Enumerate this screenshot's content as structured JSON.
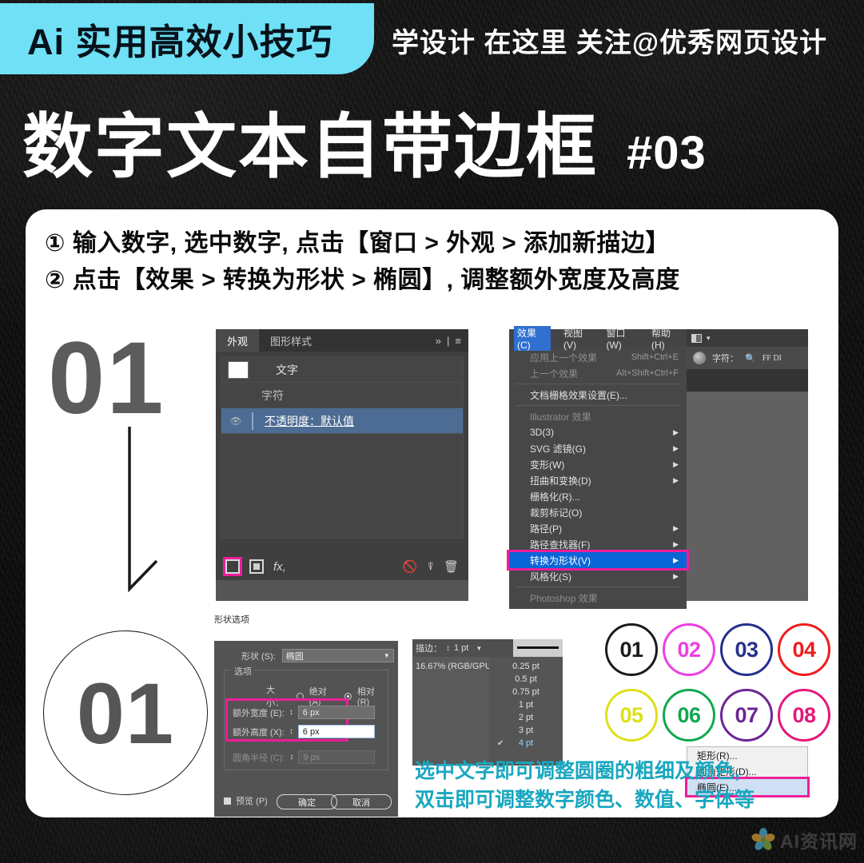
{
  "header": {
    "brand_tag": "Ai 实用高效小技巧",
    "slogan": "学设计 在这里  关注@优秀网页设计",
    "title": "数字文本自带边框",
    "issue": "#03",
    "cyan": "#6FE0F5"
  },
  "steps": [
    "① 输入数字, 选中数字, 点击【窗口 > 外观 > 添加新描边】",
    "② 点击【效果 > 转换为形状 > 椭圆】, 调整额外宽度及高度"
  ],
  "left_demo": {
    "plain_number": "01",
    "circled_number": "01"
  },
  "appearance_panel": {
    "tabs": [
      {
        "label": "外观",
        "active": true
      },
      {
        "label": "图形样式",
        "active": false
      }
    ],
    "tab_controls": {
      "expand": "»",
      "divider": "|",
      "menu": "≡"
    },
    "rows": [
      {
        "label": "文字",
        "type": "swatch",
        "selected": false
      },
      {
        "label": "字符",
        "type": "indent",
        "selected": false
      },
      {
        "label": "不透明度：默认值",
        "type": "eye",
        "selected": true
      }
    ],
    "footer_icons": [
      "add-new-stroke",
      "add-new-fill",
      "fx",
      "clear",
      "duplicate",
      "delete"
    ],
    "fx_label": "fx,",
    "tooltip": "添加新描边"
  },
  "effects_menu": {
    "menubar": [
      {
        "label": "效果(C)",
        "active": true
      },
      {
        "label": "视图(V)",
        "active": false
      },
      {
        "label": "窗口(W)",
        "active": false
      },
      {
        "label": "帮助(H)",
        "active": false
      }
    ],
    "items": [
      {
        "label": "应用上一个效果",
        "shortcut": "Shift+Ctrl+E",
        "dim": true,
        "arrow": false
      },
      {
        "label": "上一个效果",
        "shortcut": "Alt+Shift+Ctrl+F",
        "dim": true,
        "arrow": false
      },
      {
        "divider": true
      },
      {
        "label": "文档栅格效果设置(E)...",
        "shortcut": "",
        "dim": false,
        "arrow": false
      },
      {
        "divider": true
      },
      {
        "label": "Illustrator 效果",
        "shortcut": "",
        "dim": true,
        "arrow": false
      },
      {
        "label": "3D(3)",
        "shortcut": "",
        "dim": false,
        "arrow": true
      },
      {
        "label": "SVG 滤镜(G)",
        "shortcut": "",
        "dim": false,
        "arrow": true
      },
      {
        "label": "变形(W)",
        "shortcut": "",
        "dim": false,
        "arrow": true
      },
      {
        "label": "扭曲和变换(D)",
        "shortcut": "",
        "dim": false,
        "arrow": true
      },
      {
        "label": "栅格化(R)...",
        "shortcut": "",
        "dim": false,
        "arrow": false
      },
      {
        "label": "裁剪标记(O)",
        "shortcut": "",
        "dim": false,
        "arrow": false
      },
      {
        "label": "路径(P)",
        "shortcut": "",
        "dim": false,
        "arrow": true
      },
      {
        "label": "路径查找器(F)",
        "shortcut": "",
        "dim": false,
        "arrow": true
      },
      {
        "label": "转换为形状(V)",
        "shortcut": "",
        "dim": false,
        "arrow": true,
        "highlight": true
      },
      {
        "label": "风格化(S)",
        "shortcut": "",
        "dim": false,
        "arrow": true
      },
      {
        "divider": true
      },
      {
        "label": "Photoshop 效果",
        "shortcut": "",
        "dim": true,
        "arrow": false
      }
    ]
  },
  "shape_submenu": {
    "items": [
      {
        "label": "矩形(R)...",
        "highlight": false
      },
      {
        "label": "圆角矩形(D)...",
        "highlight": false
      },
      {
        "label": "椭圆(E)...",
        "highlight": true
      }
    ]
  },
  "canvas_bar": {
    "char_label": "字符：",
    "font_value": "FF DI",
    "search_icon": "search-icon"
  },
  "shape_dialog": {
    "caption": "形状选项",
    "shape_label": "形状 (S):",
    "shape_value": "椭圆",
    "options_group": "选项",
    "size_label": "大小：",
    "radio_absolute": "绝对 (A)",
    "radio_relative": "相对 (R)",
    "relative_selected": true,
    "extra_width_label": "额外宽度 (E):",
    "extra_width_value": "6 px",
    "extra_height_label": "额外高度 (X):",
    "extra_height_value": "6 px",
    "corner_radius_label": "圆角半径 (C):",
    "corner_radius_value": "9 px",
    "preview_label": "预览 (P)",
    "ok_label": "确定",
    "cancel_label": "取消"
  },
  "stroke_panel": {
    "label": "描边：",
    "value": "1 pt",
    "zoom_status": "16.67% (RGB/GPU",
    "options": [
      {
        "label": "0.25 pt",
        "selected": false
      },
      {
        "label": "0.5 pt",
        "selected": false
      },
      {
        "label": "0.75 pt",
        "selected": false
      },
      {
        "label": "1 pt",
        "selected": false
      },
      {
        "label": "2 pt",
        "selected": false
      },
      {
        "label": "3 pt",
        "selected": false
      },
      {
        "label": "4 pt",
        "selected": true
      }
    ]
  },
  "number_circles": [
    {
      "label": "01",
      "color": "#1b1b1b"
    },
    {
      "label": "02",
      "color": "#EE3FE0"
    },
    {
      "label": "03",
      "color": "#25308C"
    },
    {
      "label": "04",
      "color": "#EE1C1C"
    },
    {
      "label": "05",
      "color": "#DCE119"
    },
    {
      "label": "06",
      "color": "#11A84F"
    },
    {
      "label": "07",
      "color": "#6D2594"
    },
    {
      "label": "08",
      "color": "#E5187A"
    }
  ],
  "caption": {
    "line1": "选中文字即可调整圆圈的粗细及颜色,",
    "line2": "双击即可调整数字颜色、数值、字体等",
    "color": "#18A7BF"
  },
  "watermark": {
    "text": "AI资讯网"
  }
}
